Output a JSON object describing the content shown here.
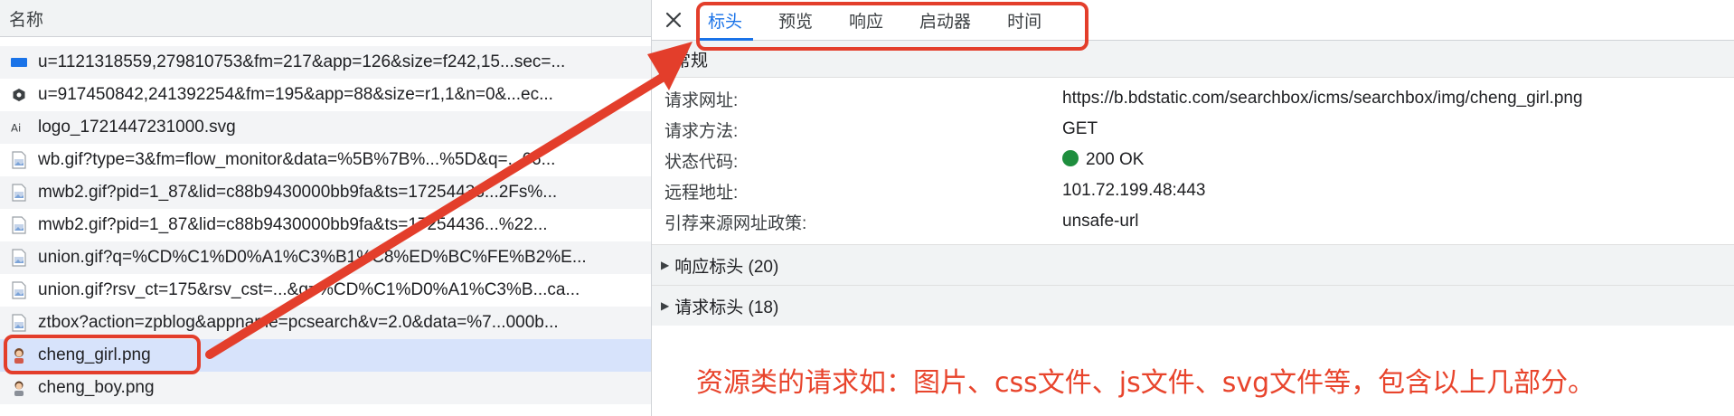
{
  "left_panel": {
    "header": "名称",
    "rows": [
      {
        "name": "u=1121318559,279810753&fm=217&app=126&size=f242,15...sec=...",
        "icon": "image-file-icon-blue",
        "selected": false
      },
      {
        "name": "u=917450842,241392254&fm=195&app=88&size=r1,1&n=0&...ec...",
        "icon": "image-file-icon-dark",
        "selected": false
      },
      {
        "name": "logo_1721447231000.svg",
        "icon": "svg-file-icon",
        "selected": false
      },
      {
        "name": "wb.gif?type=3&fm=flow_monitor&data=%5B%7B%...%5D&q=...66...",
        "icon": "image-file-icon",
        "selected": false
      },
      {
        "name": "mwb2.gif?pid=1_87&lid=c88b9430000bb9fa&ts=17254436...2Fs%...",
        "icon": "image-file-icon",
        "selected": false
      },
      {
        "name": "mwb2.gif?pid=1_87&lid=c88b9430000bb9fa&ts=17254436...%22...",
        "icon": "image-file-icon",
        "selected": false
      },
      {
        "name": "union.gif?q=%CD%C1%D0%A1%C3%B1%C8%ED%BC%FE%B2%E...",
        "icon": "image-file-icon",
        "selected": false
      },
      {
        "name": "union.gif?rsv_ct=175&rsv_cst=...&q=%CD%C1%D0%A1%C3%B...ca...",
        "icon": "image-file-icon",
        "selected": false
      },
      {
        "name": "ztbox?action=zpblog&appname=pcsearch&v=2.0&data=%7...000b...",
        "icon": "image-file-icon",
        "selected": false
      },
      {
        "name": "cheng_girl.png",
        "icon": "avatar-girl-icon",
        "selected": true
      },
      {
        "name": "cheng_boy.png",
        "icon": "avatar-boy-icon",
        "selected": false
      }
    ]
  },
  "tabs": [
    "标头",
    "预览",
    "响应",
    "启动器",
    "时间"
  ],
  "active_tab": "标头",
  "general": {
    "title": "常规",
    "rows": [
      {
        "key": "请求网址:",
        "value": "https://b.bdstatic.com/searchbox/icms/searchbox/img/cheng_girl.png"
      },
      {
        "key": "请求方法:",
        "value": "GET"
      },
      {
        "key": "状态代码:",
        "value": "200 OK"
      },
      {
        "key": "远程地址:",
        "value": "101.72.199.48:443"
      },
      {
        "key": "引荐来源网址政策:",
        "value": "unsafe-url"
      }
    ]
  },
  "response_headers": "响应标头 (20)",
  "request_headers": "请求标头 (18)",
  "annotation": "资源类的请求如：图片、css文件、js文件、svg文件等，包含以上几部分。",
  "colors": {
    "accent": "#1a73e8",
    "annotation_red": "#e33e2b",
    "status_green": "#1e8e3e",
    "selected_row": "#d7e3fb"
  }
}
